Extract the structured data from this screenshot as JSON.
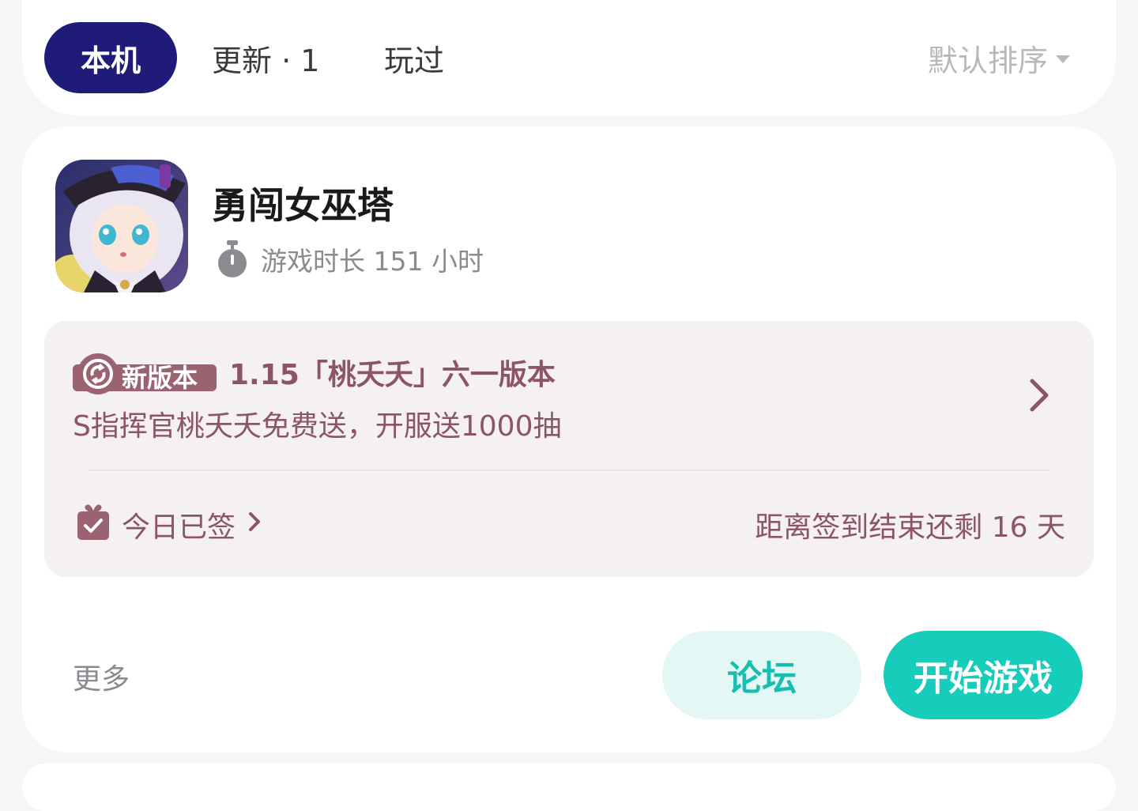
{
  "tabs": {
    "items": [
      {
        "label": "本机",
        "active": true
      },
      {
        "label": "更新 · 1",
        "active": false
      },
      {
        "label": "玩过",
        "active": false
      }
    ],
    "sort_label": "默认排序",
    "sort_icon": "caret-down-icon"
  },
  "game": {
    "title": "勇闯女巫塔",
    "playtime": "游戏时长 151 小时",
    "playtime_icon": "stopwatch-icon",
    "version": {
      "badge": "新版本",
      "title": "1.15「桃夭夭」六一版本",
      "description": "S指挥官桃夭夭免费送，开服送1000抽"
    },
    "checkin": {
      "label": "今日已签",
      "remaining": "距离签到结束还剩 16 天"
    },
    "more_label": "更多",
    "forum_label": "论坛",
    "play_label": "开始游戏"
  },
  "colors": {
    "tab_active": "#1f1b78",
    "version_text": "#8c5566",
    "version_panel": "#f5f0f2",
    "accent_teal": "#16ccba",
    "forum_bg": "#e3f7f5"
  }
}
